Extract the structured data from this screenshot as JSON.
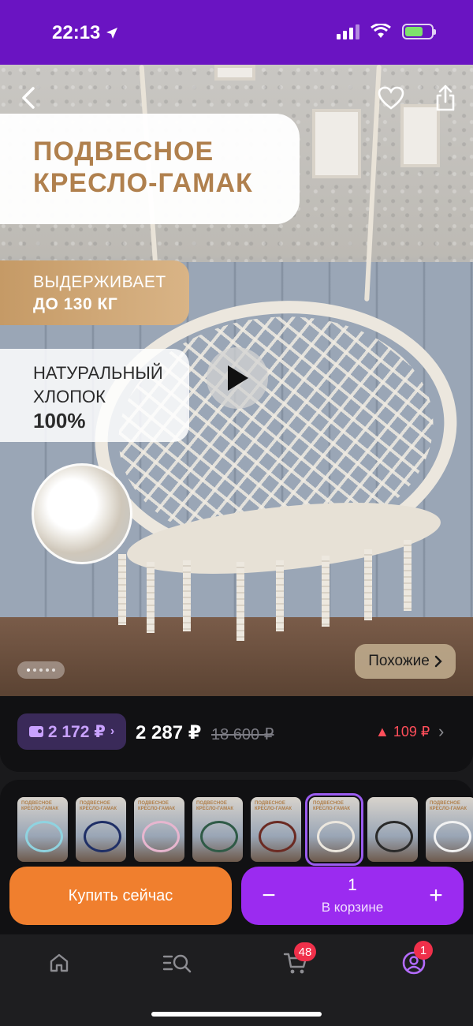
{
  "status_bar": {
    "time": "22:13"
  },
  "hero": {
    "title_line1": "ПОДВЕСНОЕ",
    "title_line2": "КРЕСЛО-ГАМАК",
    "badge1_line1": "ВЫДЕРЖИВАЕТ",
    "badge1_line2": "ДО 130 КГ",
    "badge2_line1": "НАТУРАЛЬНЫЙ",
    "badge2_line2": "ХЛОПОК",
    "badge2_line3": "100%",
    "similar_label": "Похожие",
    "slide_count": 5,
    "active_slide": 1
  },
  "price": {
    "wallet_price": "2 172 ₽",
    "current_price": "2 287 ₽",
    "old_price": "18 600 ₽",
    "price_change": "▲ 109 ₽"
  },
  "variants": {
    "items": [
      {
        "color": "#8fd3e0",
        "label_1": "ПОДВЕСНОЕ",
        "label_2": "КРЕСЛО-ГАМАК"
      },
      {
        "color": "#1f2f66",
        "label_1": "ПОДВЕСНОЕ",
        "label_2": "КРЕСЛО-ГАМАК"
      },
      {
        "color": "#e7b6cf",
        "label_1": "ПОДВЕСНОЕ",
        "label_2": "КРЕСЛО-ГАМАК"
      },
      {
        "color": "#2f5a46",
        "label_1": "ПОДВЕСНОЕ",
        "label_2": "КРЕСЛО-ГАМАК"
      },
      {
        "color": "#6b2a22",
        "label_1": "ПОДВЕСНОЕ",
        "label_2": "КРЕСЛО-ГАМАК"
      },
      {
        "color": "#ece7de",
        "label_1": "ПОДВЕСНОЕ",
        "label_2": "КРЕСЛО-ГАМАК"
      },
      {
        "color": "#2a2a2a",
        "label_1": "",
        "label_2": ""
      },
      {
        "color": "#f2f2f2",
        "label_1": "ПОДВЕСНОЕ",
        "label_2": "КРЕСЛО-ГАМАК"
      }
    ],
    "selected_index": 5
  },
  "actions": {
    "buy_label": "Купить сейчас",
    "cart_count": "1",
    "cart_label": "В корзине",
    "minus": "−",
    "plus": "+"
  },
  "nav": {
    "items": [
      {
        "name": "home",
        "icon": "home-icon"
      },
      {
        "name": "catalog",
        "icon": "catalog-search-icon"
      },
      {
        "name": "cart",
        "icon": "cart-icon",
        "badge": "48"
      },
      {
        "name": "profile",
        "icon": "profile-icon",
        "badge": "1"
      }
    ]
  },
  "colors": {
    "accent": "#6a14c2",
    "buy": "#f07f2e",
    "cart": "#9b2bf0",
    "price_up": "#ff4e5a",
    "badge": "#f0304a"
  }
}
